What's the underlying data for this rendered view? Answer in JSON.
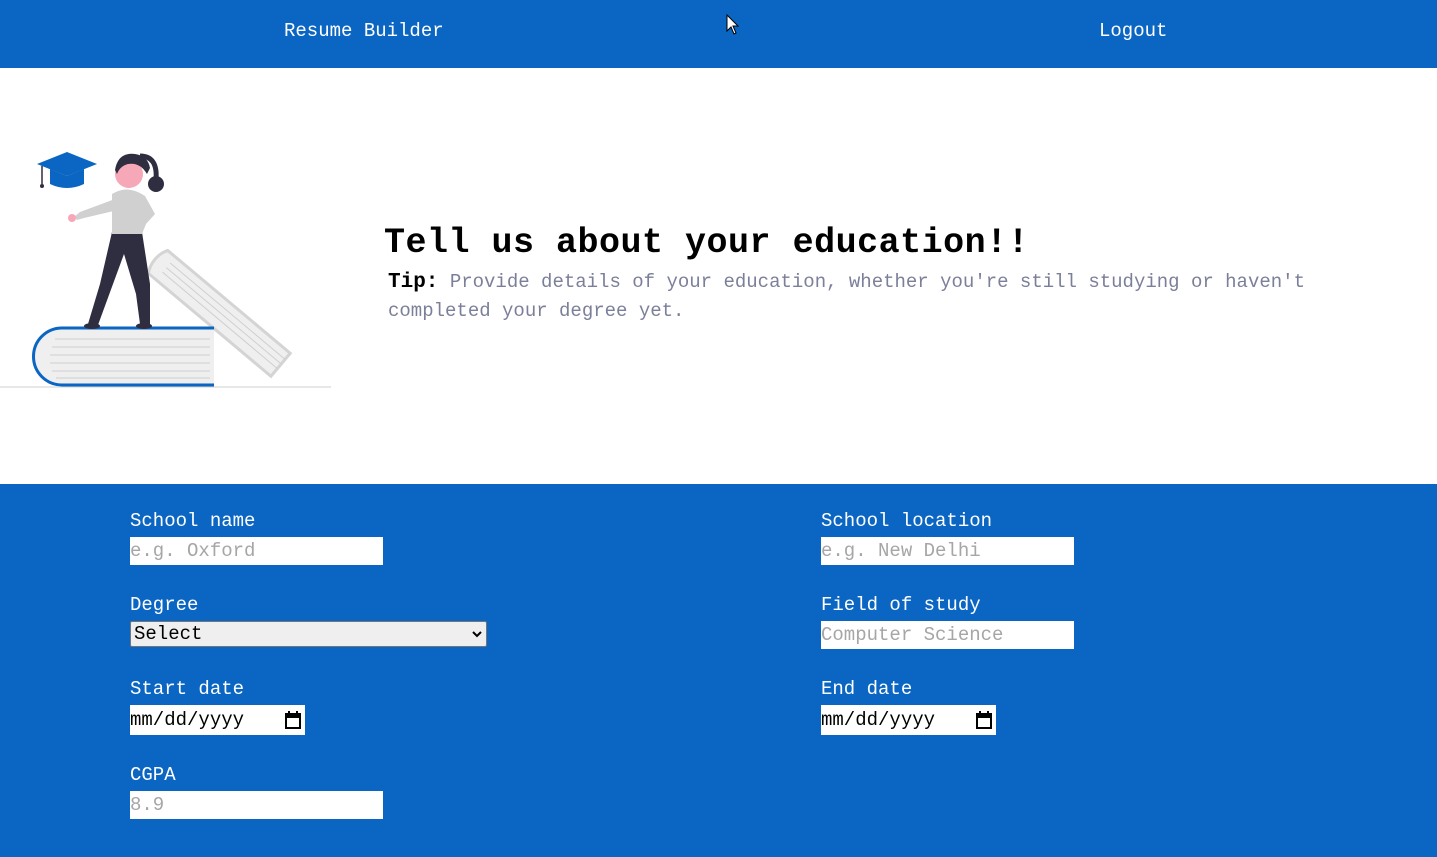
{
  "nav": {
    "brand": "Resume Builder",
    "logout": "Logout"
  },
  "hero": {
    "title": "Tell us about your education!!",
    "tip_label": "Tip:",
    "tip_text": "Provide details of your education, whether you're still studying or haven't completed your degree yet."
  },
  "form": {
    "school_name": {
      "label": "School name",
      "placeholder": "e.g. Oxford"
    },
    "school_location": {
      "label": "School location",
      "placeholder": "e.g. New Delhi"
    },
    "degree": {
      "label": "Degree",
      "value": "Select"
    },
    "field_of_study": {
      "label": "Field of study",
      "placeholder": "Computer Science"
    },
    "start_date": {
      "label": "Start date",
      "value": "mm/dd/yyyy"
    },
    "end_date": {
      "label": "End date",
      "value": "mm/dd/yyyy"
    },
    "cgpa": {
      "label": "CGPA",
      "placeholder": "8.9"
    }
  },
  "colors": {
    "primary": "#0a66c2",
    "tip_text": "#7b7f99",
    "book_gray": "#f0f0f0"
  },
  "icons": [
    "graduation-cap-icon",
    "calendar-icon",
    "chevron-down-icon",
    "cursor-icon"
  ]
}
